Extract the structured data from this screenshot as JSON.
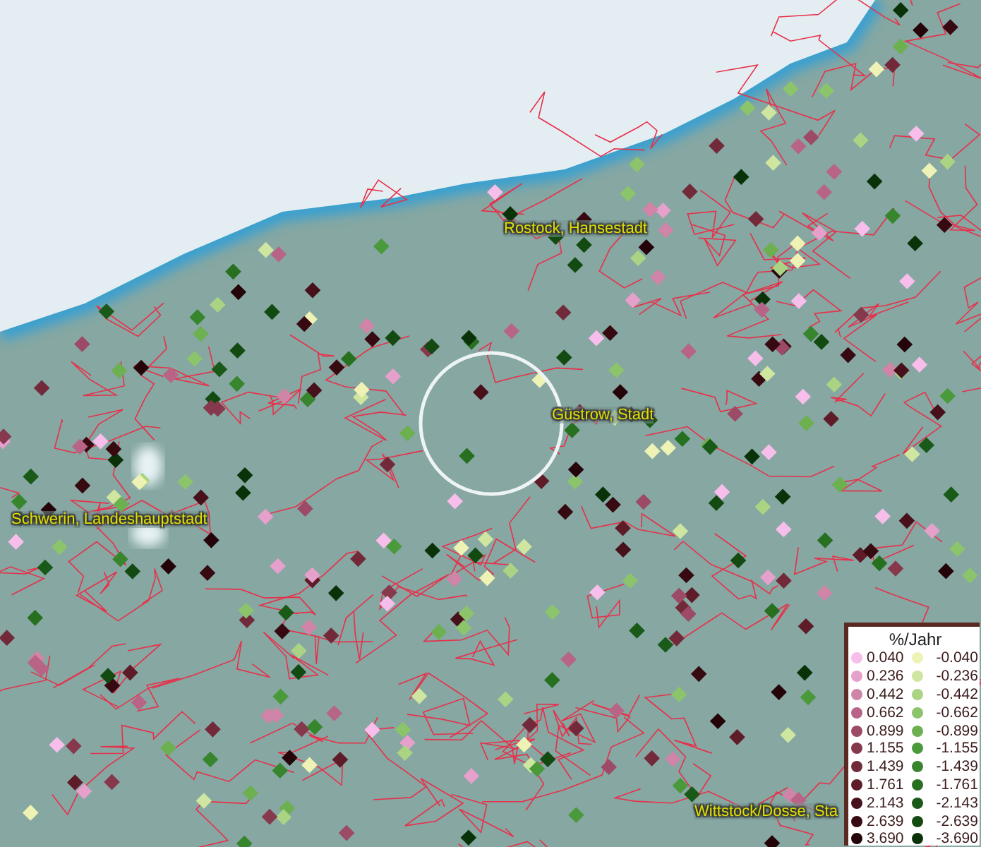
{
  "map": {
    "places": [
      {
        "name": "Rostock, Hansestadt"
      },
      {
        "name": "Güstrow, Stadt"
      },
      {
        "name": "Schwerin, Landeshauptstadt"
      },
      {
        "name": "Wittstock/Dosse, Sta"
      }
    ]
  },
  "legend": {
    "title": "%/Jahr",
    "columns": [
      [
        {
          "value": "0.040",
          "color": "#f7bdeb"
        },
        {
          "value": "0.236",
          "color": "#e6a0cc"
        },
        {
          "value": "0.442",
          "color": "#d084a8"
        },
        {
          "value": "0.662",
          "color": "#b86486"
        },
        {
          "value": "0.899",
          "color": "#9c4a66"
        },
        {
          "value": "1.155",
          "color": "#86384c"
        },
        {
          "value": "1.439",
          "color": "#722a3a"
        },
        {
          "value": "1.761",
          "color": "#5e1c28"
        },
        {
          "value": "2.143",
          "color": "#48101a"
        },
        {
          "value": "2.639",
          "color": "#360a10"
        },
        {
          "value": "3.690",
          "color": "#240408"
        }
      ],
      [
        {
          "value": "-0.040",
          "color": "#eef2b4"
        },
        {
          "value": "-0.236",
          "color": "#cfe6a0"
        },
        {
          "value": "-0.442",
          "color": "#aad484"
        },
        {
          "value": "-0.662",
          "color": "#8cc46c"
        },
        {
          "value": "-0.899",
          "color": "#6cb050"
        },
        {
          "value": "-1.155",
          "color": "#4a9a3c"
        },
        {
          "value": "-1.439",
          "color": "#37862e"
        },
        {
          "value": "-1.761",
          "color": "#267020"
        },
        {
          "value": "-2.143",
          "color": "#1a5a18"
        },
        {
          "value": "-2.639",
          "color": "#124a12"
        },
        {
          "value": "-3.690",
          "color": "#0a3208"
        }
      ]
    ]
  }
}
